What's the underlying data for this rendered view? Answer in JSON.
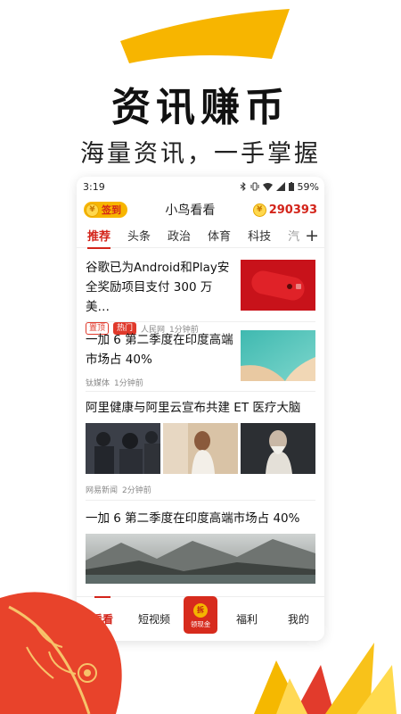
{
  "promo": {
    "headline": "资讯赚币",
    "subhead": "海量资讯，一手掌握"
  },
  "status_bar": {
    "time": "3:19",
    "battery": "59%"
  },
  "app_bar": {
    "checkin_label": "签到",
    "coin_symbol": "¥",
    "title": "小鸟看看",
    "coin_balance": "290393"
  },
  "tabs": [
    "推荐",
    "头条",
    "政治",
    "体育",
    "科技",
    "汽"
  ],
  "tab_add": "+",
  "feed": [
    {
      "title": "谷歌已为Android和Play安全奖励项目支付 300 万美…",
      "tags": [
        "置顶",
        "热门"
      ],
      "source": "人民网",
      "time": "1分钟前"
    },
    {
      "title": "一加 6 第二季度在印度高端市场占 40%",
      "source": "钛媒体",
      "time": "1分钟前"
    },
    {
      "title": "阿里健康与阿里云宣布共建 ET 医疗大脑",
      "source": "网易新闻",
      "time": "2分钟前"
    },
    {
      "title": "一加 6 第二季度在印度高端市场占 40%"
    }
  ],
  "bottom_nav": {
    "items": [
      "看看",
      "短视频",
      "福利",
      "我的"
    ],
    "center_seal": "拆",
    "center_label": "领现金"
  },
  "colors": {
    "accent": "#d3241a",
    "gold": "#f7b500"
  }
}
